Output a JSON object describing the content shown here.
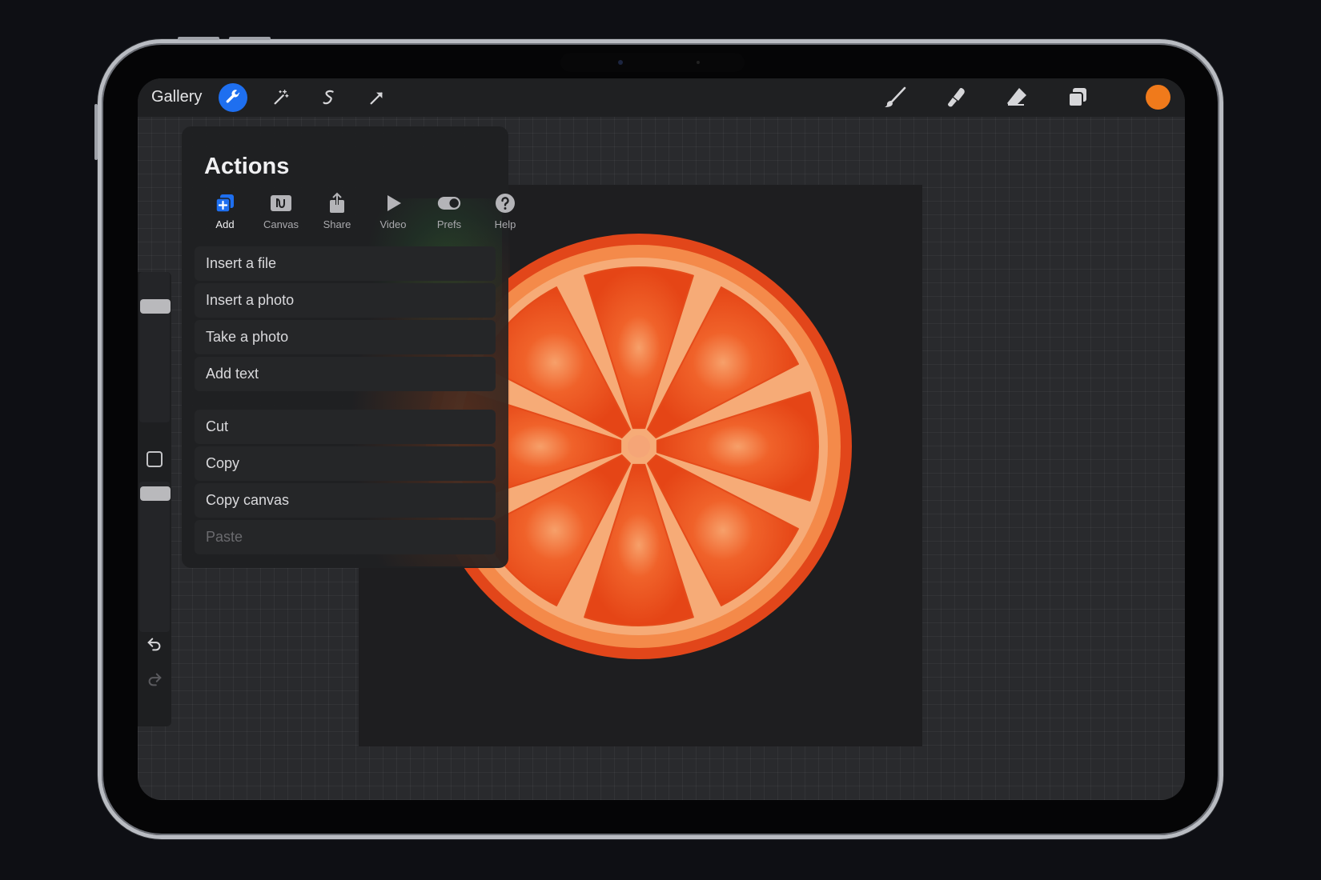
{
  "topbar": {
    "gallery_label": "Gallery",
    "active_color": "#f07a1b",
    "accent": "#1e6ff0"
  },
  "actions": {
    "title": "Actions",
    "tabs": [
      {
        "label": "Add",
        "icon": "add-layer-icon",
        "active": true
      },
      {
        "label": "Canvas",
        "icon": "canvas-icon",
        "active": false
      },
      {
        "label": "Share",
        "icon": "share-icon",
        "active": false
      },
      {
        "label": "Video",
        "icon": "play-icon",
        "active": false
      },
      {
        "label": "Prefs",
        "icon": "toggle-icon",
        "active": false
      },
      {
        "label": "Help",
        "icon": "help-icon",
        "active": false
      }
    ],
    "menu_group_1": [
      "Insert a file",
      "Insert a photo",
      "Take a photo",
      "Add text"
    ],
    "menu_group_2": [
      "Cut",
      "Copy",
      "Copy canvas",
      "Paste"
    ]
  }
}
